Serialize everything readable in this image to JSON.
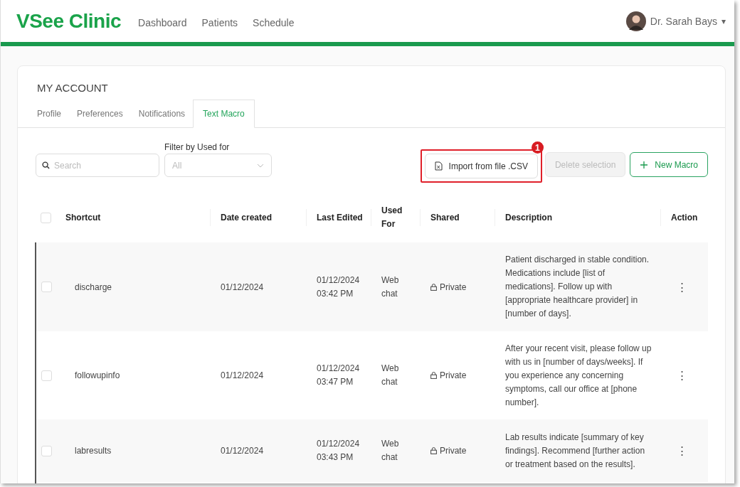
{
  "header": {
    "logo": "VSee Clinic",
    "nav": [
      {
        "label": "Dashboard"
      },
      {
        "label": "Patients"
      },
      {
        "label": "Schedule"
      }
    ],
    "user": {
      "name": "Dr. Sarah Bays",
      "caret": "▾"
    }
  },
  "page_title": "MY ACCOUNT",
  "tabs": [
    {
      "label": "Profile",
      "selected": false
    },
    {
      "label": "Preferences",
      "selected": false
    },
    {
      "label": "Notifications",
      "selected": false
    },
    {
      "label": "Text Macro",
      "selected": true
    }
  ],
  "search": {
    "placeholder": "Search"
  },
  "filter": {
    "label": "Filter by Used for",
    "value": "All"
  },
  "actions": [
    {
      "label": "Import from file .CSV",
      "kind": "import",
      "disabled": false,
      "highlighted": true,
      "badge": "1"
    },
    {
      "label": "Delete selection",
      "kind": "delete",
      "disabled": true,
      "highlighted": false
    },
    {
      "label": "New Macro",
      "kind": "new",
      "disabled": false,
      "highlighted": false
    }
  ],
  "table": {
    "select_all_checked": false,
    "columns": [
      "Shortcut",
      "Date created",
      "Last Edited",
      "Used For",
      "Shared",
      "Description",
      "Action"
    ],
    "rows": [
      {
        "checked": false,
        "shortcut": "discharge",
        "created": "01/12/2024",
        "edited": [
          "01/12/2024",
          "03:42 PM"
        ],
        "used_for": [
          "Web",
          "chat"
        ],
        "shared": "Private",
        "description": "Patient discharged in stable condition. Medications include [list of medications]. Follow up with [appropriate healthcare provider] in [number of days].",
        "action": "⋮"
      },
      {
        "checked": false,
        "shortcut": "followupinfo",
        "created": "01/12/2024",
        "edited": [
          "01/12/2024",
          "03:47 PM"
        ],
        "used_for": [
          "Web",
          "chat"
        ],
        "shared": "Private",
        "description": "After your recent visit, please follow up with us in [number of days/weeks]. If you experience any concerning symptoms, call our office at [phone number].",
        "action": "⋮"
      },
      {
        "checked": false,
        "shortcut": "labresults",
        "created": "01/12/2024",
        "edited": [
          "01/12/2024",
          "03:43 PM"
        ],
        "used_for": [
          "Web",
          "chat"
        ],
        "shared": "Private",
        "description": "Lab results indicate [summary of key findings]. Recommend [further action or treatment based on the results].",
        "action": "⋮"
      }
    ]
  }
}
